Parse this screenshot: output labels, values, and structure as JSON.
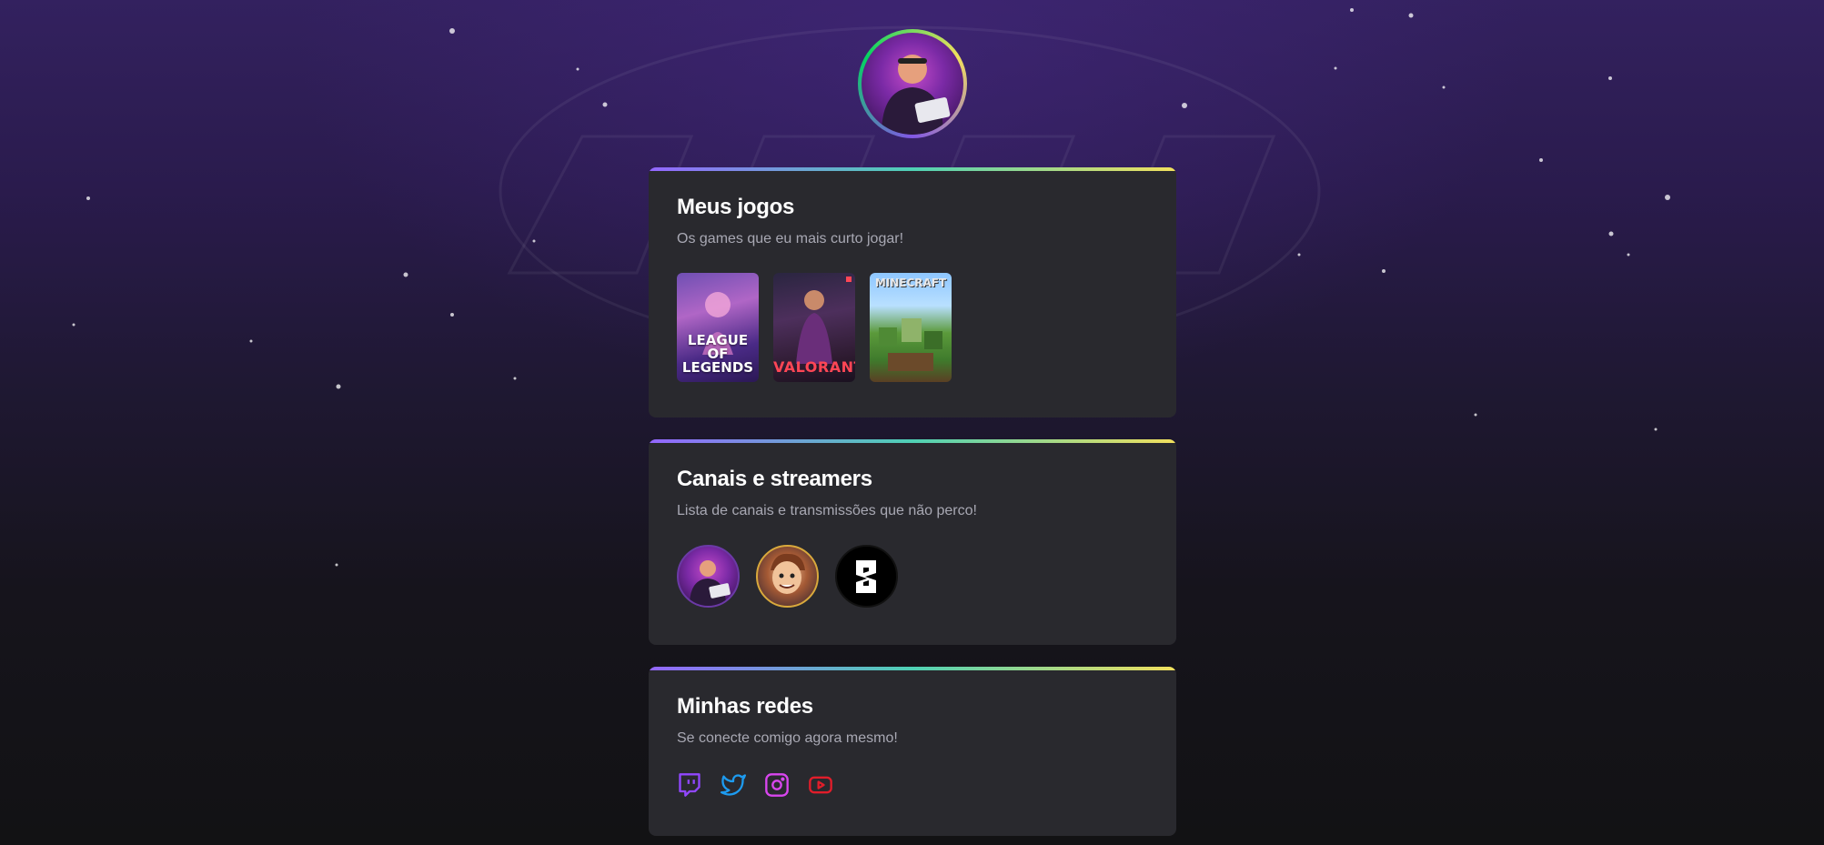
{
  "profile": {
    "avatar_icon": "gamer-avatar"
  },
  "games_section": {
    "title": "Meus jogos",
    "subtitle": "Os games que eu mais curto jogar!",
    "games": [
      {
        "name": "League of Legends",
        "label": "LEAGUE OF LEGENDS"
      },
      {
        "name": "Valorant",
        "label": "VALORANT"
      },
      {
        "name": "Minecraft",
        "label": "MINECRAFT"
      }
    ]
  },
  "channels_section": {
    "title": "Canais e streamers",
    "subtitle": "Lista de canais e transmissões que não perco!",
    "channels": [
      {
        "icon": "streamer-avatar"
      },
      {
        "icon": "cartoon-streamer-avatar"
      },
      {
        "icon": "esports-logo"
      }
    ]
  },
  "social_section": {
    "title": "Minhas redes",
    "subtitle": "Se conecte comigo agora mesmo!",
    "links": [
      {
        "icon": "twitch-icon",
        "color": "#9147ff"
      },
      {
        "icon": "twitter-icon",
        "color": "#1d9bf0"
      },
      {
        "icon": "instagram-icon",
        "color": "#e1306c"
      },
      {
        "icon": "youtube-icon",
        "color": "#ff0000"
      }
    ]
  },
  "colors": {
    "card_bg": "#29292e",
    "accent_gradient": [
      "#9466ff",
      "#4fd1b5",
      "#f2e05d"
    ],
    "page_bg": "#121214"
  }
}
